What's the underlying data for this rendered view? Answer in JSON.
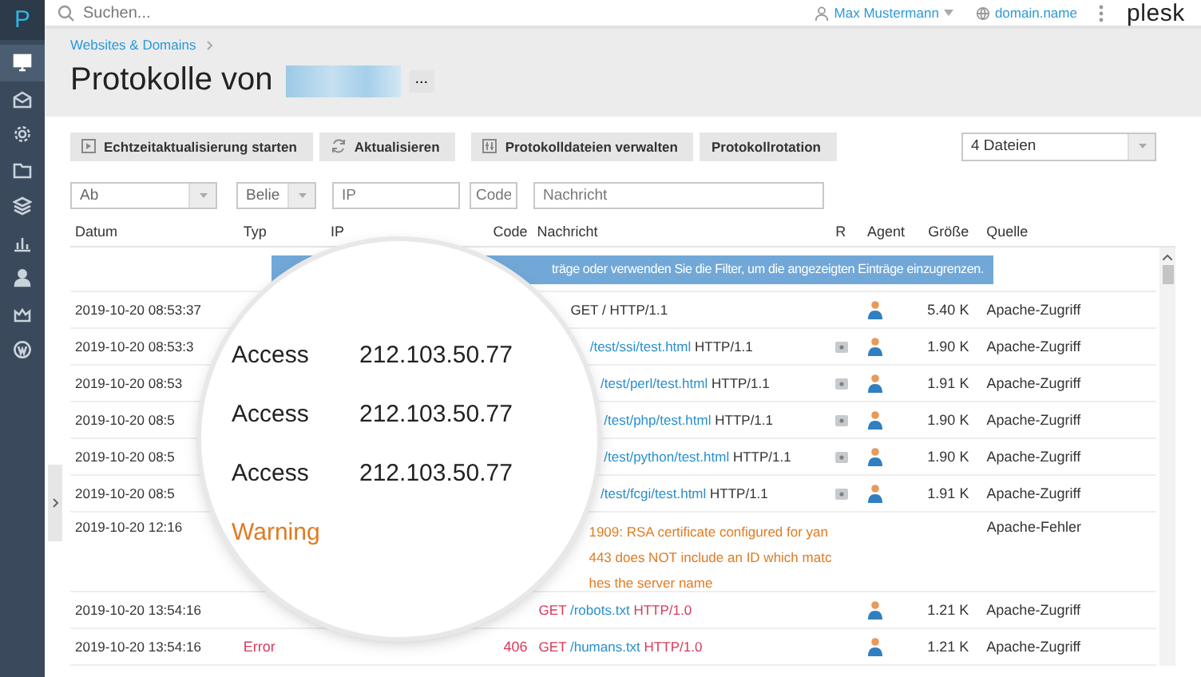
{
  "topbar": {
    "search_placeholder": "Suchen...",
    "user": "Max Mustermann",
    "domain": "domain.name",
    "logo": "plesk"
  },
  "sidebar": {
    "logo": "P",
    "items": [
      {
        "selected": true
      },
      {
        "selected": false
      },
      {
        "selected": false
      },
      {
        "selected": false
      },
      {
        "selected": false
      },
      {
        "selected": false
      },
      {
        "selected": false
      },
      {
        "selected": false
      },
      {
        "selected": false
      }
    ]
  },
  "breadcrumb": "Websites & Domains",
  "title": "Protokolle von",
  "more_button": "...",
  "toolbar": [
    "Echtzeitaktualisierung starten",
    "Aktualisieren",
    "Protokolldateien verwalten",
    "Protokollrotation"
  ],
  "file_select": "4 Dateien",
  "filters": {
    "date": "Ab",
    "type": "Belie",
    "ip_placeholder": "IP",
    "code_placeholder": "Code",
    "message_placeholder": "Nachricht"
  },
  "table": {
    "columns": [
      "Datum",
      "Typ",
      "IP",
      "Code",
      "Nachricht",
      "R",
      "Agent",
      "Größe",
      "Quelle"
    ],
    "notice": "träge oder verwenden Sie die Filter, um die angezeigten Einträge einzugrenzen.",
    "rows": [
      {
        "kind": "access",
        "date": "2019-10-20 08:53:37",
        "message": {
          "method": "GET",
          "path": "/",
          "path_link": false,
          "proto": "HTTP/1.1"
        },
        "referrer": false,
        "agent": true,
        "size": "5.40 K",
        "source": "Apache-Zugriff"
      },
      {
        "kind": "access",
        "date": "2019-10-20 08:53:3",
        "message": {
          "path": "/test/ssi/test.html",
          "path_link": true,
          "proto": "HTTP/1.1"
        },
        "referrer": true,
        "agent": true,
        "size": "1.90 K",
        "source": "Apache-Zugriff"
      },
      {
        "kind": "access",
        "date": "2019-10-20 08:53",
        "message": {
          "path": "/test/perl/test.html",
          "path_link": true,
          "proto": "HTTP/1.1"
        },
        "referrer": true,
        "agent": true,
        "size": "1.91 K",
        "source": "Apache-Zugriff"
      },
      {
        "kind": "access",
        "date": "2019-10-20 08:5",
        "message": {
          "path": "/test/php/test.html",
          "path_link": true,
          "proto": "HTTP/1.1"
        },
        "referrer": true,
        "agent": true,
        "size": "1.90 K",
        "source": "Apache-Zugriff"
      },
      {
        "kind": "access",
        "date": "2019-10-20 08:5",
        "message": {
          "path": "/test/python/test.html",
          "path_link": true,
          "proto": "HTTP/1.1"
        },
        "referrer": true,
        "agent": true,
        "size": "1.90 K",
        "source": "Apache-Zugriff"
      },
      {
        "kind": "access",
        "date": "2019-10-20 08:5",
        "message": {
          "path": "/test/fcgi/test.html",
          "path_link": true,
          "proto": "HTTP/1.1"
        },
        "referrer": true,
        "agent": true,
        "size": "1.91 K",
        "source": "Apache-Zugriff"
      },
      {
        "kind": "warning",
        "date": "2019-10-20 12:16",
        "message": {
          "lines": [
            "1909: RSA certificate configured for yan",
            "443 does NOT include an ID which matc",
            "hes the server name"
          ]
        },
        "referrer": false,
        "agent": false,
        "source": "Apache-Fehler"
      },
      {
        "kind": "error",
        "date": "2019-10-20 13:54:16",
        "message": {
          "method": "GET",
          "path": "/robots.txt",
          "path_link": true,
          "proto": "HTTP/1.0"
        },
        "referrer": false,
        "agent": true,
        "size": "1.21 K",
        "source": "Apache-Zugriff"
      },
      {
        "kind": "error",
        "date": "2019-10-20 13:54:16",
        "type": "Error",
        "code": "406",
        "message": {
          "method": "GET",
          "path": "/humans.txt",
          "path_link": true,
          "proto": "HTTP/1.0"
        },
        "referrer": false,
        "agent": true,
        "size": "1.21 K",
        "source": "Apache-Zugriff"
      }
    ]
  },
  "magnifier": {
    "rows": [
      {
        "kind": "access",
        "type": "Access",
        "ip": "212.103.50.77"
      },
      {
        "kind": "access",
        "type": "Access",
        "ip": "212.103.50.77"
      },
      {
        "kind": "access",
        "type": "Access",
        "ip": "212.103.50.77"
      },
      {
        "kind": "warning",
        "type": "Warning"
      }
    ]
  }
}
